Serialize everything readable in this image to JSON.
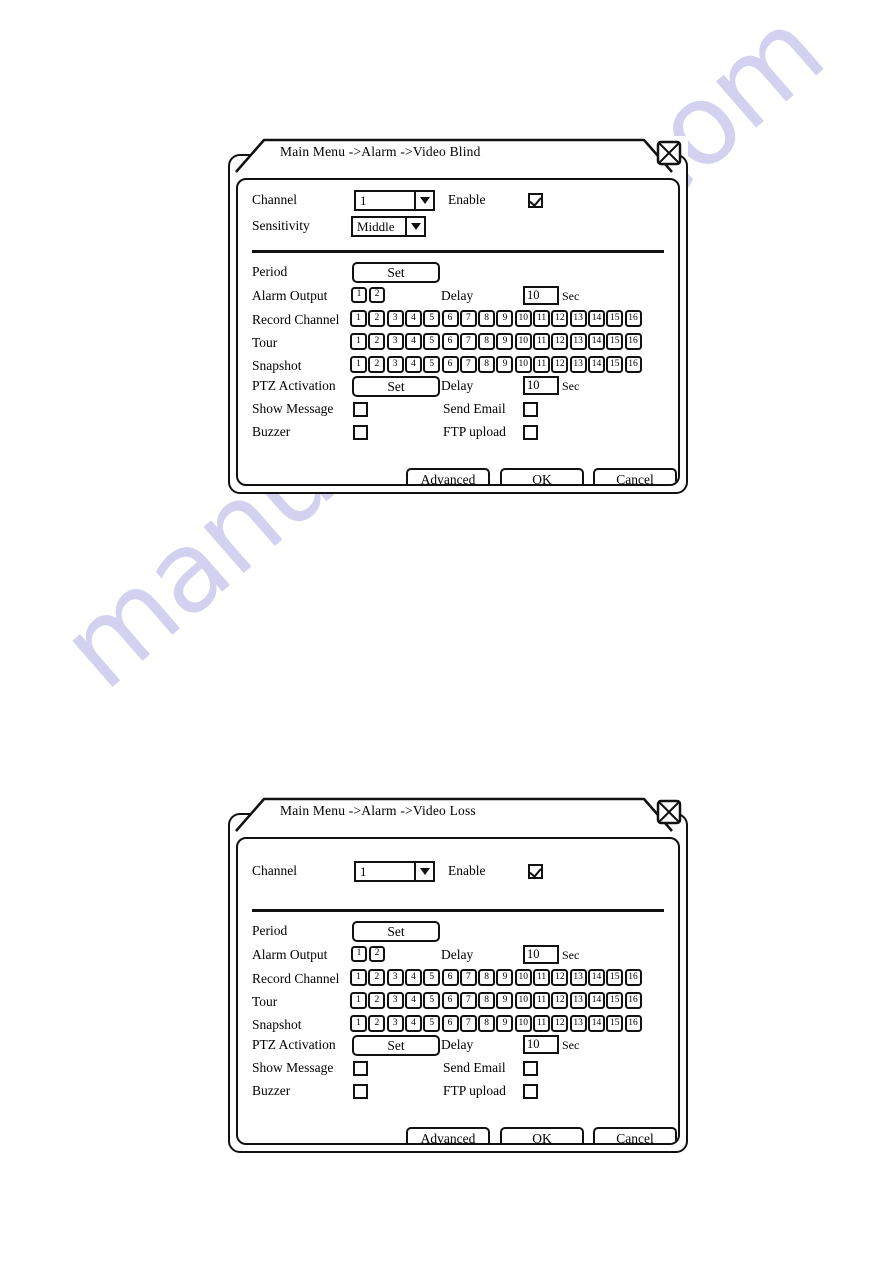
{
  "page": {
    "watermark_text": "manualshive.com",
    "watermark_color": "#b9b6e8",
    "background": "#ffffff",
    "line_color": "#111111"
  },
  "dialogs": [
    {
      "id": "video-blind",
      "title": "Main Menu ->Alarm ->Video Blind",
      "close_icon": "close-x-icon",
      "has_sensitivity": true,
      "channel": {
        "label": "Channel",
        "value": "1"
      },
      "enable": {
        "label": "Enable",
        "checked": true
      },
      "sensitivity": {
        "label": "Sensitivity",
        "value": "Middle"
      },
      "period": {
        "label": "Period",
        "button": "Set"
      },
      "alarm_output": {
        "label": "Alarm Output",
        "boxes": [
          "1",
          "2"
        ]
      },
      "delay1": {
        "label": "Delay",
        "value": "10",
        "unit": "Sec"
      },
      "record_channel": {
        "label": "Record Channel"
      },
      "tour": {
        "label": "Tour"
      },
      "snapshot": {
        "label": "Snapshot"
      },
      "channel_numbers": [
        "1",
        "2",
        "3",
        "4",
        "5",
        "6",
        "7",
        "8",
        "9",
        "10",
        "11",
        "12",
        "13",
        "14",
        "15",
        "16"
      ],
      "ptz_activation": {
        "label": "PTZ Activation",
        "button": "Set"
      },
      "delay2": {
        "label": "Delay",
        "value": "10",
        "unit": "Sec"
      },
      "show_message": {
        "label": "Show Message",
        "checked": false
      },
      "send_email": {
        "label": "Send Email",
        "checked": false
      },
      "buzzer": {
        "label": "Buzzer",
        "checked": false
      },
      "ftp_upload": {
        "label": "FTP upload",
        "checked": false
      },
      "footer": {
        "advanced": "Advanced",
        "ok": "OK",
        "cancel": "Cancel"
      }
    },
    {
      "id": "video-loss",
      "title": "Main Menu ->Alarm ->Video Loss",
      "close_icon": "close-x-icon",
      "has_sensitivity": false,
      "channel": {
        "label": "Channel",
        "value": "1"
      },
      "enable": {
        "label": "Enable",
        "checked": true
      },
      "sensitivity": {
        "label": "",
        "value": ""
      },
      "period": {
        "label": "Period",
        "button": "Set"
      },
      "alarm_output": {
        "label": "Alarm Output",
        "boxes": [
          "1",
          "2"
        ]
      },
      "delay1": {
        "label": "Delay",
        "value": "10",
        "unit": "Sec"
      },
      "record_channel": {
        "label": "Record Channel"
      },
      "tour": {
        "label": "Tour"
      },
      "snapshot": {
        "label": "Snapshot"
      },
      "channel_numbers": [
        "1",
        "2",
        "3",
        "4",
        "5",
        "6",
        "7",
        "8",
        "9",
        "10",
        "11",
        "12",
        "13",
        "14",
        "15",
        "16"
      ],
      "ptz_activation": {
        "label": "PTZ Activation",
        "button": "Set"
      },
      "delay2": {
        "label": "Delay",
        "value": "10",
        "unit": "Sec"
      },
      "show_message": {
        "label": "Show Message",
        "checked": false
      },
      "send_email": {
        "label": "Send Email",
        "checked": false
      },
      "buzzer": {
        "label": "Buzzer",
        "checked": false
      },
      "ftp_upload": {
        "label": "FTP upload",
        "checked": false
      },
      "footer": {
        "advanced": "Advanced",
        "ok": "OK",
        "cancel": "Cancel"
      }
    }
  ]
}
